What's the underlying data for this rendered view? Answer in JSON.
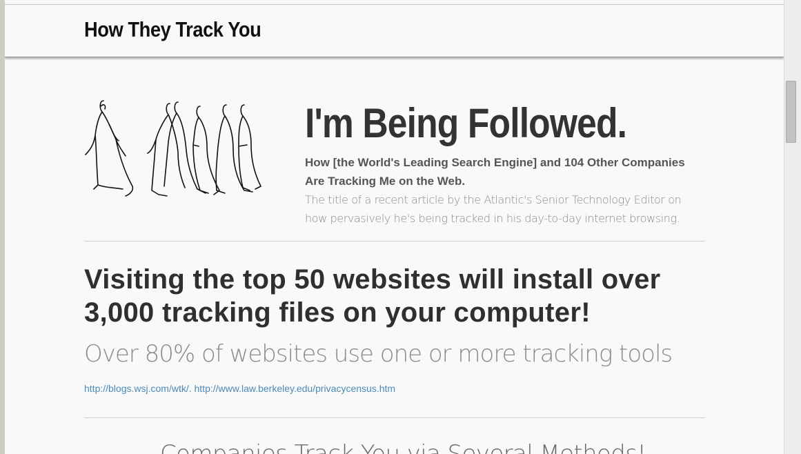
{
  "header": {
    "site_title": "How They Track You"
  },
  "hero": {
    "illustration_icon": "walking-people-sketch-icon",
    "title": "I'm Being Followed.",
    "subtitle": "How [the World's Leading Search Engine] and 104 Other Companies Are Tracking Me on the Web.",
    "description": "The title of a recent article by the Atlantic's Senior Technology Editor on how pervasively he's being tracked in his day-to-day internet browsing."
  },
  "stats": {
    "headline": "Visiting the top 50 websites will install over 3,000 tracking files on your computer!",
    "subline": "Over 80% of websites use one or more tracking tools",
    "sources": [
      "http://blogs.wsj.com/wtk/.",
      "http://www.law.berkeley.edu/privacycensus.htm"
    ]
  },
  "section": {
    "heading": "Companies Track You via Several Methods!"
  },
  "colors": {
    "page_background": "#f9f9f9",
    "title_text": "#111111",
    "body_text": "#333333",
    "light_text": "#8a8a8a",
    "link": "#4a8ab8",
    "rule": "#cfcfcf"
  }
}
